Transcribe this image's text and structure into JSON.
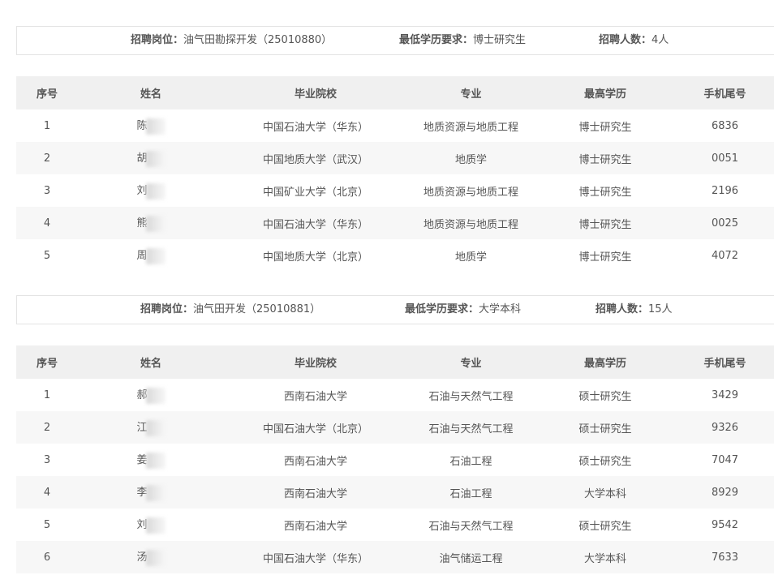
{
  "headers": [
    "序号",
    "姓名",
    "毕业院校",
    "专业",
    "最高学历",
    "手机尾号"
  ],
  "sections": [
    {
      "position_label": "招聘岗位：",
      "position_value": "油气田勘探开发（25010880）",
      "edu_label": "最低学历要求：",
      "edu_value": "博士研究生",
      "count_label": "招聘人数：",
      "count_value": "4人",
      "rows": [
        {
          "no": "1",
          "name": "陈",
          "school": "中国石油大学（华东）",
          "major": "地质资源与地质工程",
          "degree": "博士研究生",
          "phone": "6836"
        },
        {
          "no": "2",
          "name": "胡",
          "school": "中国地质大学（武汉）",
          "major": "地质学",
          "degree": "博士研究生",
          "phone": "0051"
        },
        {
          "no": "3",
          "name": "刘",
          "school": "中国矿业大学（北京）",
          "major": "地质资源与地质工程",
          "degree": "博士研究生",
          "phone": "2196"
        },
        {
          "no": "4",
          "name": "熊",
          "school": "中国石油大学（华东）",
          "major": "地质资源与地质工程",
          "degree": "博士研究生",
          "phone": "0025"
        },
        {
          "no": "5",
          "name": "周",
          "school": "中国地质大学（北京）",
          "major": "地质学",
          "degree": "博士研究生",
          "phone": "4072"
        }
      ]
    },
    {
      "position_label": "招聘岗位：",
      "position_value": "油气田开发（25010881）",
      "edu_label": "最低学历要求：",
      "edu_value": "大学本科",
      "count_label": "招聘人数：",
      "count_value": "15人",
      "rows": [
        {
          "no": "1",
          "name": "郝",
          "school": "西南石油大学",
          "major": "石油与天然气工程",
          "degree": "硕士研究生",
          "phone": "3429"
        },
        {
          "no": "2",
          "name": "江",
          "school": "中国石油大学（北京）",
          "major": "石油与天然气工程",
          "degree": "硕士研究生",
          "phone": "9326"
        },
        {
          "no": "3",
          "name": "姜",
          "school": "西南石油大学",
          "major": "石油工程",
          "degree": "硕士研究生",
          "phone": "7047"
        },
        {
          "no": "4",
          "name": "李",
          "school": "西南石油大学",
          "major": "石油工程",
          "degree": "大学本科",
          "phone": "8929"
        },
        {
          "no": "5",
          "name": "刘",
          "school": "西南石油大学",
          "major": "石油与天然气工程",
          "degree": "硕士研究生",
          "phone": "9542"
        },
        {
          "no": "6",
          "name": "汤",
          "school": "中国石油大学（华东）",
          "major": "油气储运工程",
          "degree": "大学本科",
          "phone": "7633"
        }
      ]
    }
  ]
}
